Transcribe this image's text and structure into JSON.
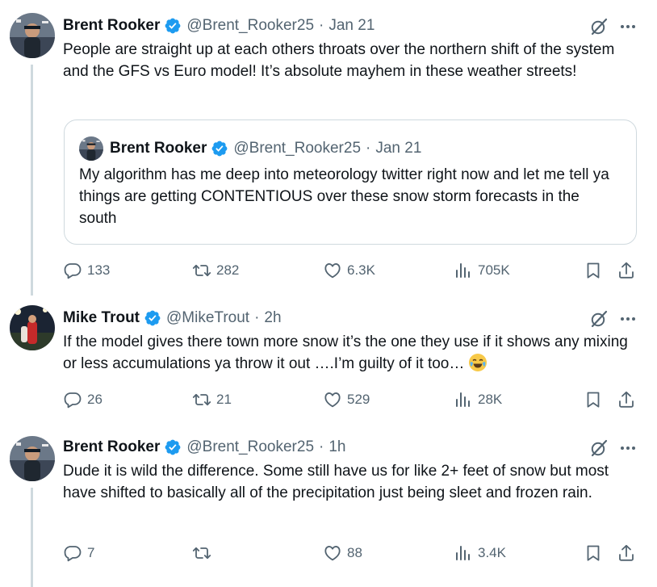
{
  "tweets": [
    {
      "name": "Brent Rooker",
      "handle": "@Brent_Rooker25",
      "separator": "·",
      "time": "Jan 21",
      "text": "People are straight up at each others  throats over the northern shift of the system and the GFS vs Euro model! It’s absolute mayhem in these weather streets!",
      "quote": {
        "name": "Brent Rooker",
        "handle": "@Brent_Rooker25",
        "separator": "·",
        "time": "Jan 21",
        "text": "My algorithm has me deep into meteorology twitter right now and let me tell ya things are getting CONTENTIOUS over these snow storm forecasts in the south"
      },
      "stats": {
        "replies": "133",
        "reposts": "282",
        "likes": "6.3K",
        "views": "705K"
      }
    },
    {
      "name": "Mike Trout",
      "handle": "@MikeTrout",
      "separator": "·",
      "time": "2h",
      "text": "If the model gives there town more snow it’s the one they use if it shows any mixing or  less accumulations ya throw it out ….I’m guilty of it too…",
      "emoji": "face-with-tears-of-joy",
      "stats": {
        "replies": "26",
        "reposts": "21",
        "likes": "529",
        "views": "28K"
      }
    },
    {
      "name": "Brent Rooker",
      "handle": "@Brent_Rooker25",
      "separator": "·",
      "time": "1h",
      "text": "Dude it is wild the difference. Some still have us for like 2+ feet of snow but most have shifted to basically all of the precipitation just being sleet and frozen rain.",
      "stats": {
        "replies": "7",
        "reposts": "",
        "likes": "88",
        "views": "3.4K"
      }
    }
  ],
  "colors": {
    "verified": "#1d9bf0",
    "muted": "#536471",
    "text": "#0f1419",
    "border": "#cfd9de"
  },
  "icons": [
    "verified-badge-icon",
    "grok-icon",
    "more-icon",
    "reply-icon",
    "repost-icon",
    "like-icon",
    "views-icon",
    "bookmark-icon",
    "share-icon"
  ]
}
